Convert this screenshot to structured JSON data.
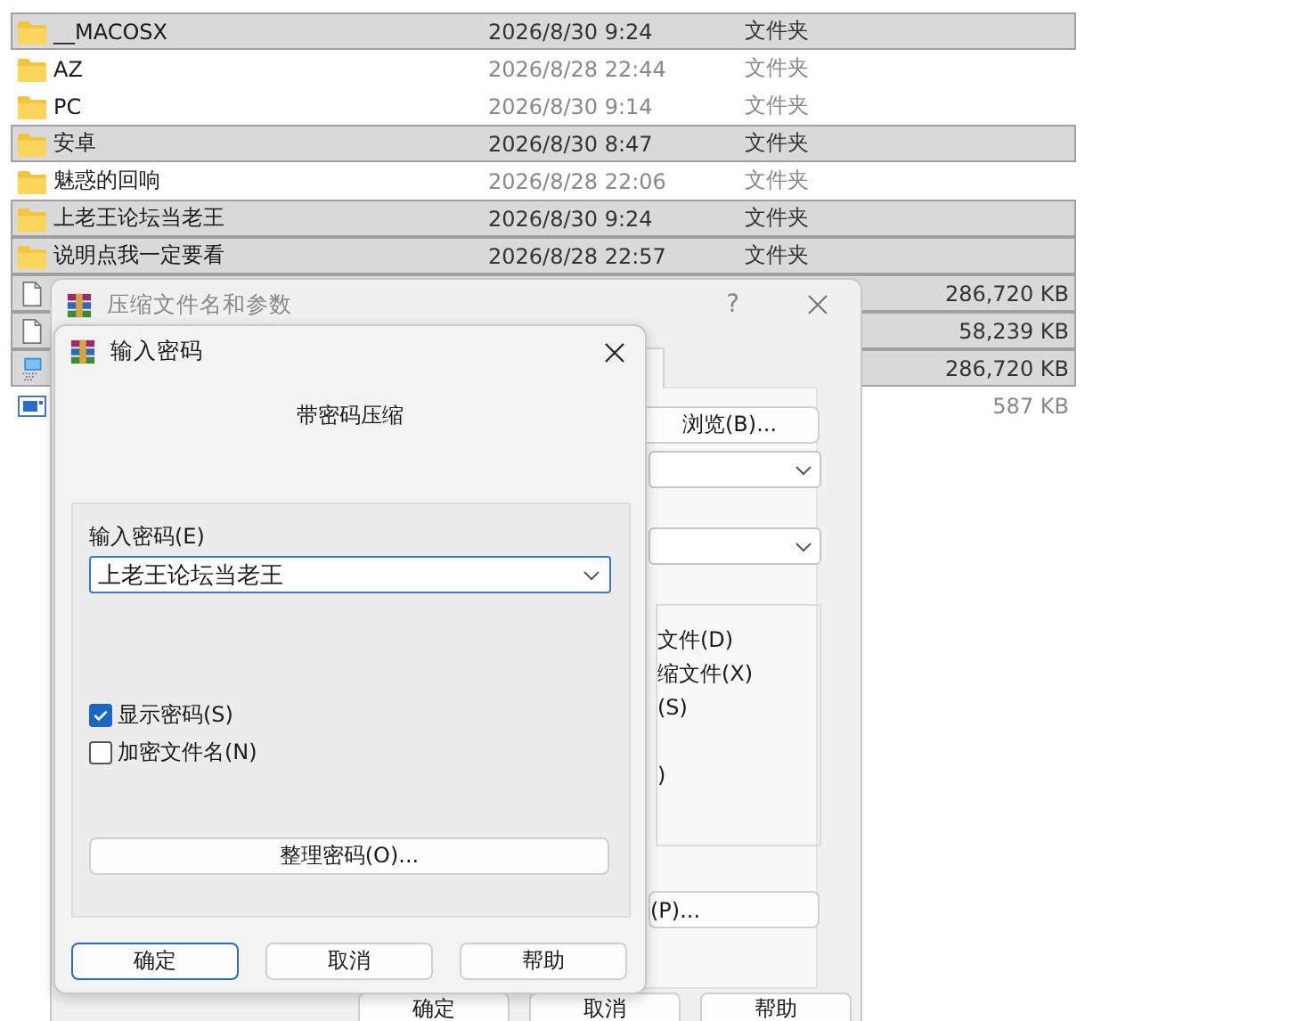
{
  "file_list": {
    "rows": [
      {
        "kind": "folder",
        "name": "__MACOSX",
        "modified": "2026/8/30 9:24",
        "type": "文件夹",
        "selected": true
      },
      {
        "kind": "folder",
        "name": "AZ",
        "modified": "2026/8/28 22:44",
        "type": "文件夹",
        "selected": false
      },
      {
        "kind": "folder",
        "name": "PC",
        "modified": "2026/8/30 9:14",
        "type": "文件夹",
        "selected": false
      },
      {
        "kind": "folder",
        "name": "安卓",
        "modified": "2026/8/30 8:47",
        "type": "文件夹",
        "selected": true
      },
      {
        "kind": "folder",
        "name": "魅惑的回响",
        "modified": "2026/8/28 22:06",
        "type": "文件夹",
        "selected": false
      },
      {
        "kind": "folder",
        "name": "上老王论坛当老王",
        "modified": "2026/8/30 9:24",
        "type": "文件夹",
        "selected": true
      },
      {
        "kind": "folder",
        "name": "说明点我一定要看",
        "modified": "2026/8/28 22:57",
        "type": "文件夹",
        "selected": true
      },
      {
        "kind": "document",
        "size": "286,720 KB",
        "selected": true
      },
      {
        "kind": "document",
        "size": "58,239 KB",
        "selected": true
      },
      {
        "kind": "network",
        "size": "286,720 KB",
        "selected": true
      },
      {
        "kind": "image",
        "size": "587 KB",
        "selected": false
      }
    ]
  },
  "archive_dialog": {
    "title": "压缩文件名和参数",
    "help": "?",
    "browse_button": "浏览(B)...",
    "options": [
      "文件(D)",
      "缩文件(X)",
      "(S)",
      ")"
    ],
    "button": "(P)...",
    "footer_buttons": [
      "确定",
      "取消",
      "帮助"
    ]
  },
  "password_dialog": {
    "title": "输入密码",
    "heading": "带密码压缩",
    "password_label": "输入密码(E)",
    "password": "上老王论坛当老王",
    "checkboxes": [
      {
        "label": "显示密码(S)",
        "checked": true
      },
      {
        "label": "加密文件名(N)",
        "checked": false
      }
    ],
    "organize_button": "整理密码(O)...",
    "buttons": [
      {
        "label": "确定",
        "default": true
      },
      {
        "label": "取消",
        "default": false
      },
      {
        "label": "帮助",
        "default": false
      }
    ]
  }
}
